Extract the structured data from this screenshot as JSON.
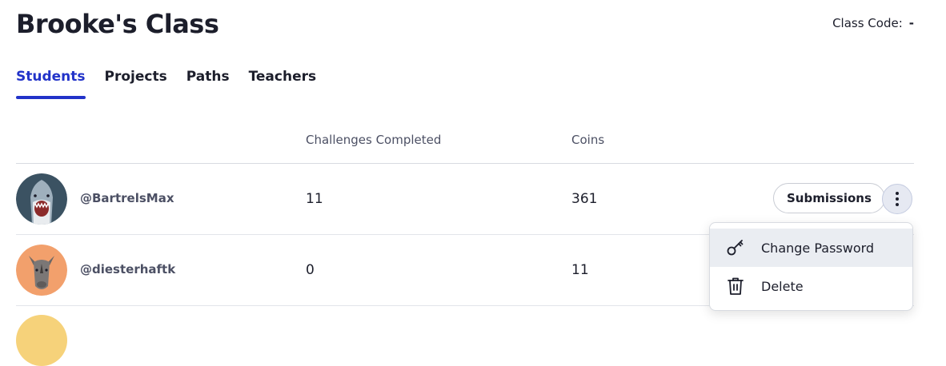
{
  "page": {
    "title": "Brooke's Class"
  },
  "class_code": {
    "label": "Class Code:",
    "value": "-"
  },
  "tabs": [
    {
      "label": "Students",
      "active": true
    },
    {
      "label": "Projects",
      "active": false
    },
    {
      "label": "Paths",
      "active": false
    },
    {
      "label": "Teachers",
      "active": false
    }
  ],
  "table": {
    "columns": {
      "challenges": "Challenges Completed",
      "coins": "Coins"
    },
    "rows": [
      {
        "username": "@BartrelsMax",
        "challenges": "11",
        "coins": "361",
        "avatar": "shark-icon",
        "avatar_bg": "#3b5262"
      },
      {
        "username": "@diesterhaftk",
        "challenges": "0",
        "coins": "11",
        "avatar": "rhino-icon",
        "avatar_bg": "#f2a06c"
      }
    ]
  },
  "actions": {
    "submissions_label": "Submissions",
    "more_icon": "kebab-menu-icon"
  },
  "menu": {
    "items": [
      {
        "label": "Change Password",
        "icon": "key-icon"
      },
      {
        "label": "Delete",
        "icon": "trash-icon"
      }
    ]
  },
  "colors": {
    "accent": "#2233c9",
    "text": "#1c1e2b",
    "muted": "#4c5064"
  }
}
